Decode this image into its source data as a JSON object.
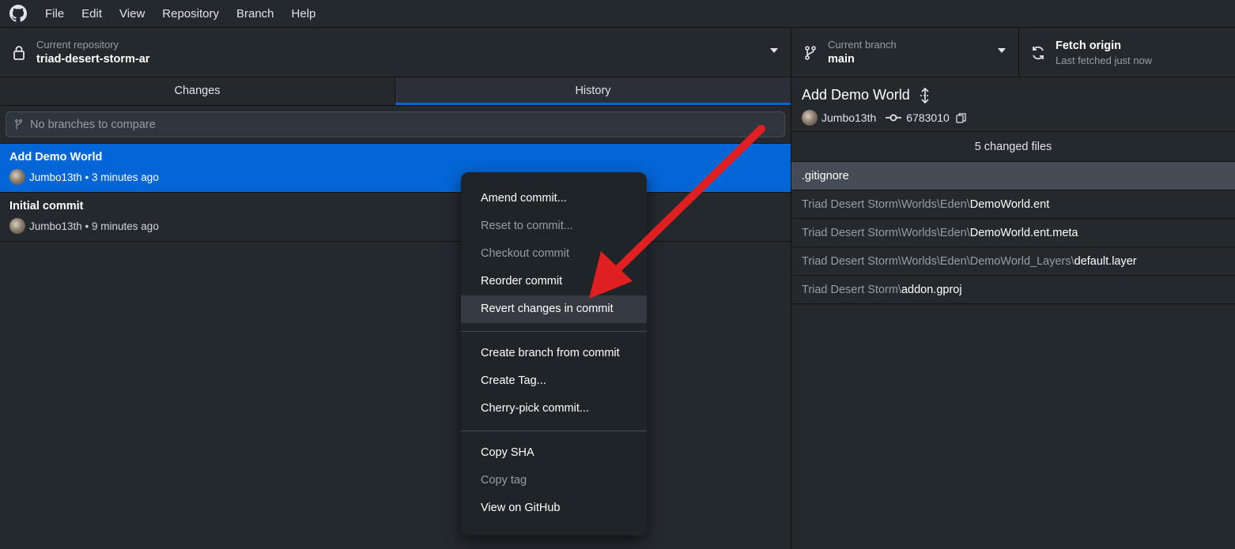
{
  "menubar": {
    "items": [
      "File",
      "Edit",
      "View",
      "Repository",
      "Branch",
      "Help"
    ]
  },
  "toolbar": {
    "repo_label": "Current repository",
    "repo_value": "triad-desert-storm-ar",
    "branch_label": "Current branch",
    "branch_value": "main",
    "fetch_label": "Fetch origin",
    "fetch_sub": "Last fetched just now"
  },
  "left": {
    "tabs": [
      "Changes",
      "History"
    ],
    "active_tab": "History",
    "compare_placeholder": "No branches to compare",
    "commits": [
      {
        "title": "Add Demo World",
        "meta": "Jumbo13th • 3 minutes ago"
      },
      {
        "title": "Initial commit",
        "meta": "Jumbo13th • 9 minutes ago"
      }
    ]
  },
  "right": {
    "commit_title": "Add Demo World",
    "author": "Jumbo13th",
    "sha": "6783010",
    "changed_files": "5 changed files",
    "files": [
      {
        "path": "",
        "name": ".gitignore"
      },
      {
        "path": "Triad Desert Storm\\Worlds\\Eden\\",
        "name": "DemoWorld.ent"
      },
      {
        "path": "Triad Desert Storm\\Worlds\\Eden\\",
        "name": "DemoWorld.ent.meta"
      },
      {
        "path": "Triad Desert Storm\\Worlds\\Eden\\DemoWorld_Layers\\",
        "name": "default.layer"
      },
      {
        "path": "Triad Desert Storm\\",
        "name": "addon.gproj"
      }
    ]
  },
  "context_menu": {
    "group1": [
      {
        "label": "Amend commit...",
        "disabled": false
      },
      {
        "label": "Reset to commit...",
        "disabled": true
      },
      {
        "label": "Checkout commit",
        "disabled": true
      },
      {
        "label": "Reorder commit",
        "disabled": false
      },
      {
        "label": "Revert changes in commit",
        "disabled": false,
        "hover": true
      }
    ],
    "group2": [
      {
        "label": "Create branch from commit",
        "disabled": false
      },
      {
        "label": "Create Tag...",
        "disabled": false
      },
      {
        "label": "Cherry-pick commit...",
        "disabled": false
      }
    ],
    "group3": [
      {
        "label": "Copy SHA",
        "disabled": false
      },
      {
        "label": "Copy tag",
        "disabled": true
      },
      {
        "label": "View on GitHub",
        "disabled": false
      }
    ]
  },
  "colors": {
    "accent": "#0366d6",
    "annotation_arrow": "#e02020"
  }
}
